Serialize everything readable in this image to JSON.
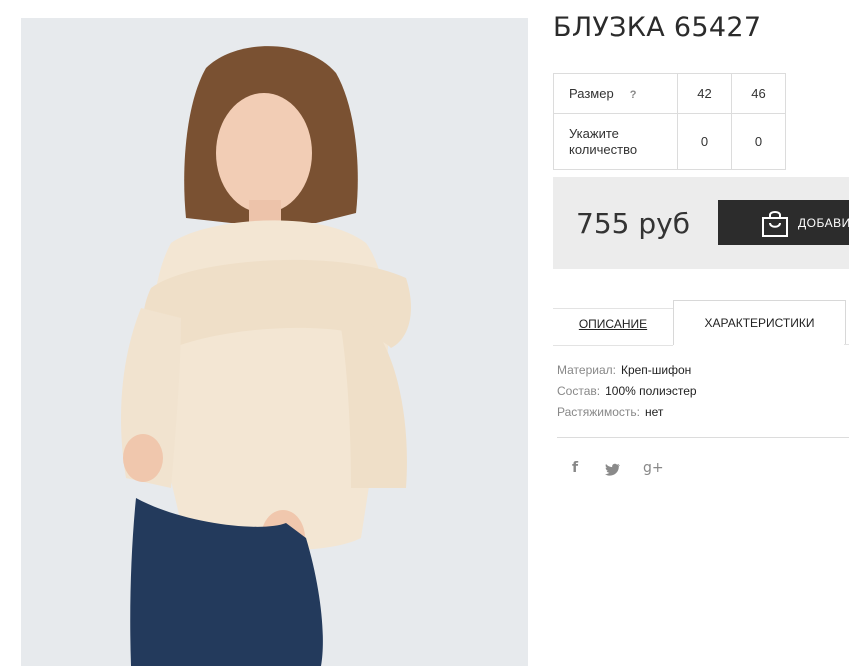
{
  "product": {
    "title": "БЛУЗКА 65427",
    "photo_alt": "Блузка 65427"
  },
  "size_table": {
    "size_label": "Размер",
    "help_icon_label": "?",
    "sizes": [
      "42",
      "46"
    ],
    "quantity_label_line1": "Укажите",
    "quantity_label_line2": "количество",
    "quantities": [
      "0",
      "0"
    ]
  },
  "purchase": {
    "price": "755 руб",
    "add_button_label": "ДОБАВИ",
    "button_color": "#2c2c2c",
    "box_color": "#ececec"
  },
  "tabs": [
    {
      "label": "ОПИСАНИЕ",
      "active": false
    },
    {
      "label": "ХАРАКТЕРИСТИКИ",
      "active": true
    }
  ],
  "specs": [
    {
      "key": "Материал:",
      "value": "Креп-шифон"
    },
    {
      "key": "Состав:",
      "value": "100% полиэстер"
    },
    {
      "key": "Растяжимость:",
      "value": "нет"
    }
  ],
  "social": {
    "facebook_icon": "f",
    "twitter_icon": "t",
    "googleplus_icon": "g+"
  }
}
